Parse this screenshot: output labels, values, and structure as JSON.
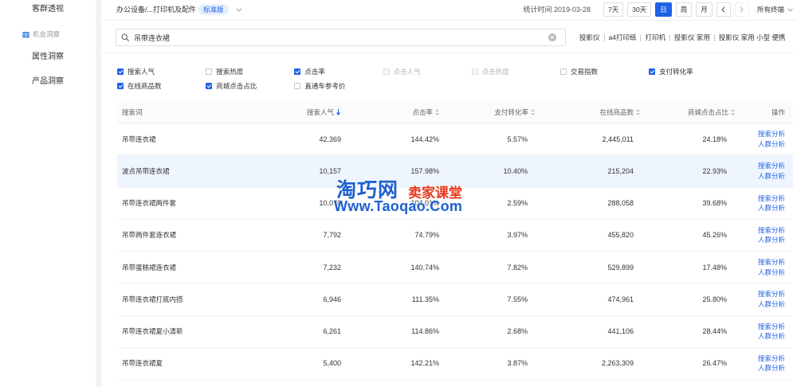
{
  "sidebar": {
    "items": [
      {
        "label": "客群透视"
      },
      {
        "label": "机会洞察",
        "icon": "book-icon",
        "group_header": true
      },
      {
        "label": "属性洞察"
      },
      {
        "label": "产品洞察"
      }
    ]
  },
  "topbar": {
    "category": "办公设备/...打印机及配件",
    "edition_badge": "标准版",
    "stat_time": "统计时间 2019-03-28",
    "periods": [
      {
        "label": "7天",
        "selected": false
      },
      {
        "label": "30天",
        "selected": false
      },
      {
        "label": "日",
        "selected": true
      },
      {
        "label": "周",
        "selected": false
      },
      {
        "label": "月",
        "selected": false
      }
    ],
    "prev_icon": "chevron-left-icon",
    "next_icon": "chevron-right-icon",
    "next_disabled": true,
    "terminal": "所有终端"
  },
  "search": {
    "value": "吊带连衣裙",
    "related": [
      "投影仪",
      "a4打印纸",
      "打印机",
      "投影仪 家用",
      "投影仪 家用 小型 便携"
    ]
  },
  "metrics": [
    {
      "label": "搜索人气",
      "checked": true,
      "disabled": false
    },
    {
      "label": "搜索热度",
      "checked": false,
      "disabled": false
    },
    {
      "label": "点击率",
      "checked": true,
      "disabled": false
    },
    {
      "label": "点击人气",
      "checked": false,
      "disabled": true
    },
    {
      "label": "点击热度",
      "checked": false,
      "disabled": true
    },
    {
      "label": "交易指数",
      "checked": false,
      "disabled": false
    },
    {
      "label": "支付转化率",
      "checked": true,
      "disabled": false
    },
    {
      "label": "在线商品数",
      "checked": true,
      "disabled": false
    },
    {
      "label": "商城点击占比",
      "checked": true,
      "disabled": false
    },
    {
      "label": "直通车参考价",
      "checked": false,
      "disabled": false
    }
  ],
  "table": {
    "headers": [
      {
        "label": "搜索词",
        "sortable": false
      },
      {
        "label": "搜索人气",
        "sortable": true,
        "sort": "desc"
      },
      {
        "label": "点击率",
        "sortable": true,
        "sort": "none"
      },
      {
        "label": "支付转化率",
        "sortable": true,
        "sort": "none"
      },
      {
        "label": "在线商品数",
        "sortable": true,
        "sort": "none"
      },
      {
        "label": "商城点击占比",
        "sortable": true,
        "sort": "none"
      },
      {
        "label": "操作",
        "sortable": false
      }
    ],
    "rows": [
      {
        "keyword": "吊带连衣裙",
        "search_popularity": "42,369",
        "click_rate": "144.42%",
        "pay_conversion": "5.57%",
        "online_items": "2,445,011",
        "mall_click_share": "24.18%",
        "highlighted": false
      },
      {
        "keyword": "波点吊带连衣裙",
        "search_popularity": "10,157",
        "click_rate": "157.98%",
        "pay_conversion": "10.40%",
        "online_items": "215,204",
        "mall_click_share": "22.93%",
        "highlighted": true
      },
      {
        "keyword": "吊带连衣裙两件套",
        "search_popularity": "10,078",
        "click_rate": "104.01%",
        "pay_conversion": "2.59%",
        "online_items": "288,058",
        "mall_click_share": "39.68%",
        "highlighted": false
      },
      {
        "keyword": "吊带两件套连衣裙",
        "search_popularity": "7,792",
        "click_rate": "74.79%",
        "pay_conversion": "3.97%",
        "online_items": "455,820",
        "mall_click_share": "45.26%",
        "highlighted": false
      },
      {
        "keyword": "吊带蛋糕裙连衣裙",
        "search_popularity": "7,232",
        "click_rate": "140.74%",
        "pay_conversion": "7.82%",
        "online_items": "529,899",
        "mall_click_share": "17.48%",
        "highlighted": false
      },
      {
        "keyword": "吊带连衣裙打底内搭",
        "search_popularity": "6,946",
        "click_rate": "111.35%",
        "pay_conversion": "7.55%",
        "online_items": "474,961",
        "mall_click_share": "25.80%",
        "highlighted": false
      },
      {
        "keyword": "吊带连衣裙夏小清新",
        "search_popularity": "6,261",
        "click_rate": "114.86%",
        "pay_conversion": "2.68%",
        "online_items": "441,106",
        "mall_click_share": "28.44%",
        "highlighted": false
      },
      {
        "keyword": "吊带连衣裙夏",
        "search_popularity": "5,400",
        "click_rate": "142.21%",
        "pay_conversion": "3.87%",
        "online_items": "2,263,309",
        "mall_click_share": "26.47%",
        "highlighted": false
      }
    ],
    "actions": [
      "搜索分析",
      "人群分析"
    ]
  },
  "watermark": {
    "brand": "淘巧网",
    "tagline": "卖家课堂",
    "url": "Www.Taoqao.Com"
  },
  "colors": {
    "accent": "#2062e6",
    "highlight_row": "#eef5ff",
    "watermark_blue": "#1d5fd0",
    "watermark_red": "#e53a1e"
  }
}
